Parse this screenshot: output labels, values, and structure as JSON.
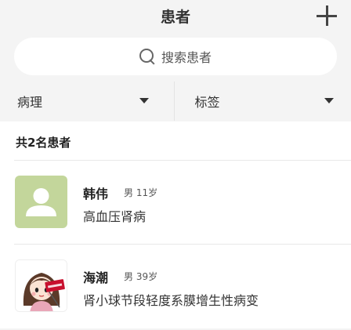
{
  "header": {
    "title": "患者",
    "add_icon": "plus-icon"
  },
  "search": {
    "placeholder": "搜索患者",
    "icon": "search-icon"
  },
  "filters": [
    {
      "label": "病理",
      "icon": "caret-down-icon"
    },
    {
      "label": "标签",
      "icon": "caret-down-icon"
    }
  ],
  "list": {
    "count_label": "共2名患者",
    "patients": [
      {
        "name": "韩伟",
        "gender": "男",
        "age": "11岁",
        "diagnosis": "高血压肾病",
        "avatar": "default-user-avatar"
      },
      {
        "name": "海潮",
        "gender": "男",
        "age": "39岁",
        "diagnosis": "肾小球节段轻度系膜增生性病变",
        "avatar": "cartoon-girl-photo"
      }
    ]
  },
  "colors": {
    "default_avatar_bg": "#c3d69b",
    "background": "#f4f4f4",
    "sign_red": "#c8102e"
  }
}
